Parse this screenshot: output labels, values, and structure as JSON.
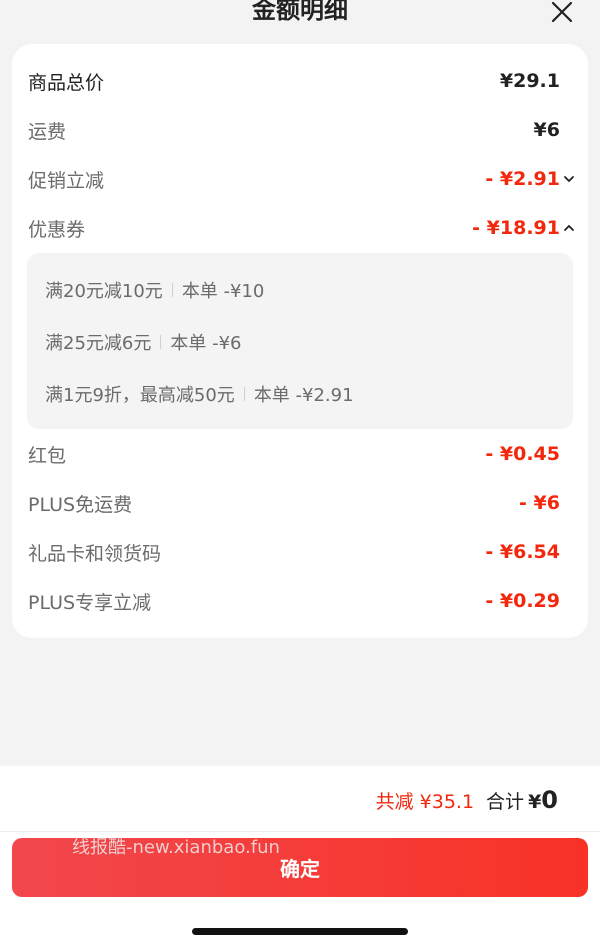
{
  "header": {
    "title": "金额明细"
  },
  "summary_rows": [
    {
      "label": "商品总价",
      "value": "¥29.1"
    },
    {
      "label": "运费",
      "value": "¥6"
    },
    {
      "label": "促销立减",
      "value": "- ¥2.91"
    },
    {
      "label": "优惠券",
      "value": "- ¥18.91"
    }
  ],
  "coupons": [
    {
      "name": "满20元减10元",
      "deduction": "本单 -¥10"
    },
    {
      "name": "满25元减6元",
      "deduction": "本单 -¥6"
    },
    {
      "name": "满1元9折，最高减50元",
      "deduction": "本单 -¥2.91"
    }
  ],
  "discount_rows": [
    {
      "label": "红包",
      "value": "- ¥0.45"
    },
    {
      "label": "PLUS免运费",
      "value": "- ¥6"
    },
    {
      "label": "礼品卡和领货码",
      "value": "- ¥6.54"
    },
    {
      "label": "PLUS专享立减",
      "value": "- ¥0.29"
    }
  ],
  "footer": {
    "saved": "共减 ¥35.1",
    "total_label": "合计",
    "total_currency": "¥",
    "total_value": "0",
    "confirm_label": "确定",
    "watermark": "线报酷-new.xianbao.fun"
  },
  "colors": {
    "accent": "#f2270c",
    "button": "#f83226"
  }
}
